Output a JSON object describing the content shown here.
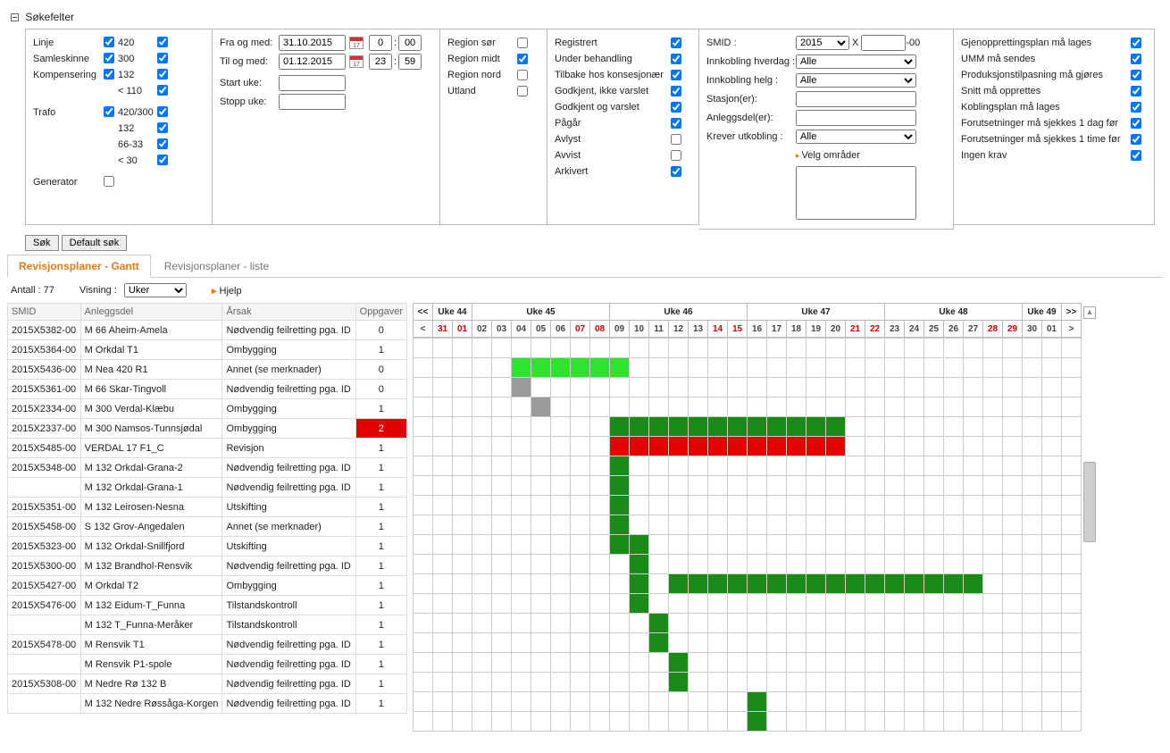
{
  "section_header": "Søkefelter",
  "filters": {
    "linje_label": "Linje",
    "samleskinne_label": "Samleskinne",
    "kompensering_label": "Kompensering",
    "trafo_label": "Trafo",
    "generator_label": "Generator",
    "v420": "420",
    "v300": "300",
    "v132": "132",
    "vlt110": "< 110",
    "t420_300": "420/300",
    "t132": "132",
    "t66_33": "66-33",
    "tlt30": "< 30"
  },
  "dates": {
    "fra_label": "Fra og med:",
    "til_label": "Til og med:",
    "start_uke": "Start uke:",
    "stopp_uke": "Stopp uke:",
    "fra": "31.10.2015",
    "til": "01.12.2015",
    "fra_h": "0",
    "fra_m": "00",
    "til_h": "23",
    "til_m": "59"
  },
  "regions": {
    "sor": "Region sør",
    "midt": "Region midt",
    "nord": "Region nord",
    "utland": "Utland"
  },
  "status": {
    "registrert": "Registrert",
    "under": "Under behandling",
    "tilbake": "Tilbake hos konsesjonær",
    "godkjent_ikke": "Godkjent, ikke varslet",
    "godkjent_varslet": "Godkjent og varslet",
    "pagar": "Pågår",
    "avlyst": "Avlyst",
    "avvist": "Avvist",
    "arkivert": "Arkivert"
  },
  "smid_panel": {
    "smid_label": "SMID :",
    "year": "2015",
    "x": "X",
    "suffix": "-00",
    "innk_hverdag": "Innkobling hverdag :",
    "innk_helg": "Innkobling helg :",
    "stasjoner": "Stasjon(er):",
    "anleggsdeler": "Anleggsdel(er):",
    "krever": "Krever utkobling :",
    "alle": "Alle",
    "velg": "Velg områder"
  },
  "krav": {
    "gjen": "Gjenopprettingsplan må lages",
    "umm": "UMM må sendes",
    "prod": "Produksjonstilpasning må gjøres",
    "snitt": "Snitt må opprettes",
    "kobl": "Koblingsplan må lages",
    "for1d": "Forutsetninger må sjekkes 1 dag før",
    "for1t": "Forutsetninger må sjekkes 1 time før",
    "ingen": "Ingen krav"
  },
  "buttons": {
    "sok": "Søk",
    "default": "Default søk"
  },
  "tabs": {
    "gantt": "Revisjonsplaner - Gantt",
    "liste": "Revisjonsplaner - liste"
  },
  "toolbar": {
    "antall": "Antall : 77",
    "visning": "Visning :",
    "uker": "Uker",
    "hjelp": "Hjelp"
  },
  "grid_headers": {
    "smid": "SMID",
    "anl": "Anleggsdel",
    "ars": "Årsak",
    "opp": "Oppgaver"
  },
  "weeks": {
    "w44": "Uke 44",
    "w45": "Uke 45",
    "w46": "Uke 46",
    "w47": "Uke 47",
    "w48": "Uke 48",
    "w49": "Uke 49",
    "nav_ll": "<<",
    "nav_l": "<",
    "nav_r": ">",
    "nav_rr": ">>"
  },
  "days": [
    "31",
    "01",
    "02",
    "03",
    "04",
    "05",
    "06",
    "07",
    "08",
    "09",
    "10",
    "11",
    "12",
    "13",
    "14",
    "15",
    "16",
    "17",
    "18",
    "19",
    "20",
    "21",
    "22",
    "23",
    "24",
    "25",
    "26",
    "27",
    "28",
    "29",
    "30",
    "01"
  ],
  "day_sun_idx": [
    0,
    1,
    7,
    8,
    14,
    15,
    21,
    22,
    28,
    29
  ],
  "rows": [
    {
      "smid": "2015X5382-00",
      "anl": "M 66 Aheim-Amela",
      "ars": "Nødvendig feilretting pga. ID",
      "opp": "0",
      "bars": []
    },
    {
      "smid": "2015X5364-00",
      "anl": "M Orkdal T1",
      "ars": "Ombygging",
      "opp": "1",
      "bars": [
        {
          "s": 4,
          "e": 9,
          "c": "g-lgreen"
        }
      ]
    },
    {
      "smid": "2015X5436-00",
      "anl": "M Nea 420 R1",
      "ars": "Annet (se merknader)",
      "opp": "0",
      "bars": [
        {
          "s": 4,
          "e": 4,
          "c": "g-grey"
        }
      ]
    },
    {
      "smid": "2015X5361-00",
      "anl": "M 66 Skar-Tingvoll",
      "ars": "Nødvendig feilretting pga. ID",
      "opp": "0",
      "bars": [
        {
          "s": 5,
          "e": 5,
          "c": "g-grey"
        }
      ]
    },
    {
      "smid": "2015X2334-00",
      "anl": "M 300 Verdal-Klæbu",
      "ars": "Ombygging",
      "opp": "1",
      "bars": [
        {
          "s": 9,
          "e": 20,
          "c": "g-dgreen"
        }
      ]
    },
    {
      "smid": "2015X2337-00",
      "anl": "M 300 Namsos-Tunnsjødal",
      "ars": "Ombygging",
      "opp": "2",
      "opp_bad": true,
      "bars": [
        {
          "s": 9,
          "e": 20,
          "c": "g-red"
        }
      ]
    },
    {
      "smid": "2015X5485-00",
      "anl": "VERDAL 17 F1_C",
      "ars": "Revisjon",
      "opp": "1",
      "bars": [
        {
          "s": 9,
          "e": 9,
          "c": "g-dgreen"
        }
      ]
    },
    {
      "smid": "2015X5348-00",
      "anl": "M 132 Orkdal-Grana-2",
      "ars": "Nødvendig feilretting pga. ID",
      "opp": "1",
      "bars": [
        {
          "s": 9,
          "e": 9,
          "c": "g-dgreen"
        }
      ]
    },
    {
      "smid": "",
      "anl": "M 132 Orkdal-Grana-1",
      "ars": "Nødvendig feilretting pga. ID",
      "opp": "1",
      "bars": [
        {
          "s": 9,
          "e": 9,
          "c": "g-dgreen"
        }
      ]
    },
    {
      "smid": "2015X5351-00",
      "anl": "M 132 Leirosen-Nesna",
      "ars": "Utskifting",
      "opp": "1",
      "bars": [
        {
          "s": 9,
          "e": 9,
          "c": "g-dgreen"
        }
      ]
    },
    {
      "smid": "2015X5458-00",
      "anl": "S 132 Grov-Angedalen",
      "ars": "Annet (se merknader)",
      "opp": "1",
      "bars": [
        {
          "s": 9,
          "e": 10,
          "c": "g-dgreen"
        }
      ]
    },
    {
      "smid": "2015X5323-00",
      "anl": "M 132 Orkdal-Snillfjord",
      "ars": "Utskifting",
      "opp": "1",
      "bars": [
        {
          "s": 10,
          "e": 10,
          "c": "g-dgreen"
        }
      ]
    },
    {
      "smid": "2015X5300-00",
      "anl": "M 132 Brandhol-Rensvik",
      "ars": "Nødvendig feilretting pga. ID",
      "opp": "1",
      "bars": [
        {
          "s": 10,
          "e": 10,
          "c": "g-dgreen"
        },
        {
          "s": 12,
          "e": 27,
          "c": "g-dgreen"
        }
      ]
    },
    {
      "smid": "2015X5427-00",
      "anl": "M Orkdal T2",
      "ars": "Ombygging",
      "opp": "1",
      "bars": [
        {
          "s": 10,
          "e": 10,
          "c": "g-dgreen"
        }
      ]
    },
    {
      "smid": "2015X5476-00",
      "anl": "M 132 Eidum-T_Funna",
      "ars": "Tilstandskontroll",
      "opp": "1",
      "bars": [
        {
          "s": 11,
          "e": 11,
          "c": "g-dgreen"
        }
      ]
    },
    {
      "smid": "",
      "anl": "M 132 T_Funna-Meråker",
      "ars": "Tilstandskontroll",
      "opp": "1",
      "bars": [
        {
          "s": 11,
          "e": 11,
          "c": "g-dgreen"
        }
      ]
    },
    {
      "smid": "2015X5478-00",
      "anl": "M Rensvik T1",
      "ars": "Nødvendig feilretting pga. ID",
      "opp": "1",
      "bars": [
        {
          "s": 12,
          "e": 12,
          "c": "g-dgreen"
        }
      ]
    },
    {
      "smid": "",
      "anl": "M Rensvik P1-spole",
      "ars": "Nødvendig feilretting pga. ID",
      "opp": "1",
      "bars": [
        {
          "s": 12,
          "e": 12,
          "c": "g-dgreen"
        }
      ]
    },
    {
      "smid": "2015X5308-00",
      "anl": "M Nedre Rø 132 B",
      "ars": "Nødvendig feilretting pga. ID",
      "opp": "1",
      "bars": [
        {
          "s": 16,
          "e": 16,
          "c": "g-dgreen"
        }
      ]
    },
    {
      "smid": "",
      "anl": "M 132 Nedre Røssåga-Korgen",
      "ars": "Nødvendig feilretting pga. ID",
      "opp": "1",
      "bars": [
        {
          "s": 16,
          "e": 16,
          "c": "g-dgreen"
        }
      ]
    }
  ]
}
